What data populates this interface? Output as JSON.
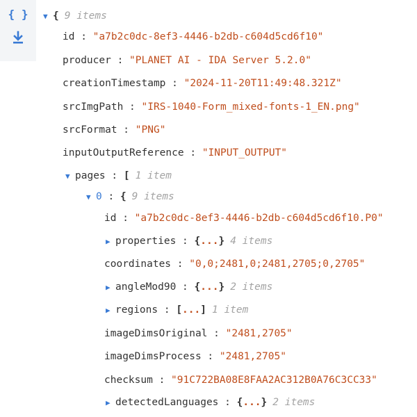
{
  "toolbar": {
    "braces_label": "{ }",
    "braces_color": "#3a7bd5",
    "download_color": "#3a7bd5"
  },
  "root": {
    "open": "{",
    "count": "9 items",
    "id_key": "id",
    "id_val": "\"a7b2c0dc-8ef3-4446-b2db-c604d5cd6f10\"",
    "producer_key": "producer",
    "producer_val": "\"PLANET AI - IDA Server 5.2.0\"",
    "creation_key": "creationTimestamp",
    "creation_val": "\"2024-11-20T11:49:48.321Z\"",
    "src_key": "srcImgPath",
    "src_val": "\"IRS-1040-Form_mixed-fonts-1_EN.png\"",
    "format_key": "srcFormat",
    "format_val": "\"PNG\"",
    "ioref_key": "inputOutputReference",
    "ioref_val": "\"INPUT_OUTPUT\""
  },
  "pages": {
    "key": "pages",
    "open": "[",
    "count": "1 item",
    "item0": {
      "index": "0",
      "open": "{",
      "count": "9 items",
      "id_key": "id",
      "id_val": "\"a7b2c0dc-8ef3-4446-b2db-c604d5cd6f10.P0\"",
      "properties_key": "properties",
      "properties_val": "{...}",
      "properties_count": "4 items",
      "coords_key": "coordinates",
      "coords_val": "\"0,0;2481,0;2481,2705;0,2705\"",
      "angle_key": "angleMod90",
      "angle_val": "{...}",
      "angle_count": "2 items",
      "regions_key": "regions",
      "regions_val": "[...]",
      "regions_count": "1 item",
      "dimsorig_key": "imageDimsOriginal",
      "dimsorig_val": "\"2481,2705\"",
      "dimsproc_key": "imageDimsProcess",
      "dimsproc_val": "\"2481,2705\"",
      "checksum_key": "checksum",
      "checksum_val": "\"91C722BA08E8FAA2AC312B0A76C3CC33\"",
      "langs_key": "detectedLanguages",
      "langs_val": "{...}",
      "langs_count": "2 items"
    }
  }
}
